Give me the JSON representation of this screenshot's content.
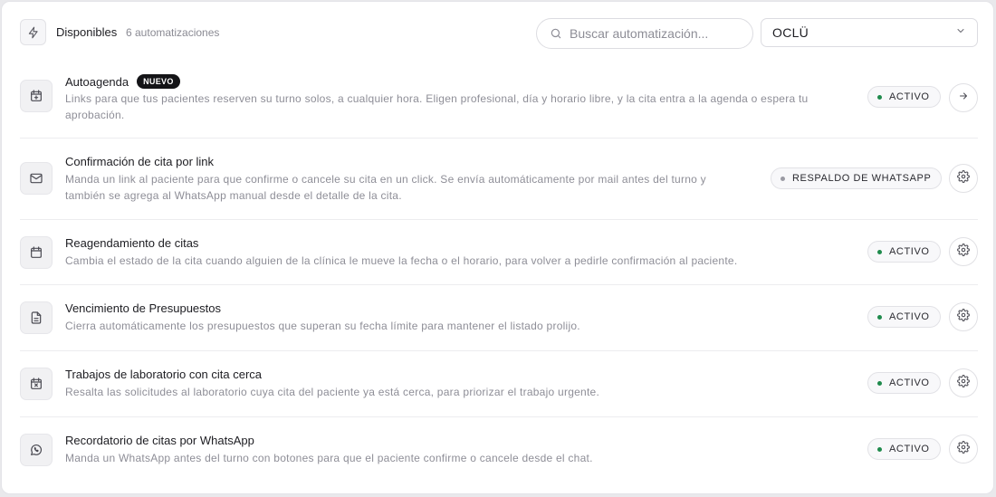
{
  "header": {
    "icon": "bolt-icon",
    "title": "Disponibles",
    "count": "6 automatizaciones",
    "search_placeholder": "Buscar automatización...",
    "select_value": "OCLÜ"
  },
  "colors": {
    "active_dot": "#1f8a4c",
    "backup_dot": "#9a9aa3",
    "badge_bg": "#141417"
  },
  "automations": [
    {
      "icon": "calendar-plus-icon",
      "name": "Autoagenda",
      "badge": "NUEVO",
      "desc_line1": "Links para que tus pacientes reserven su turno solos, a cualquier hora. Eligen profesional, día y horario libre, y la cita entra a la agenda o espera tu",
      "desc_line2": "aprobación.",
      "status": "ACTIVO",
      "action_icon": "arrow-right-icon"
    },
    {
      "icon": "mail-icon",
      "name": "Confirmación de cita por link",
      "desc_line1": "Manda un link al paciente para que confirme o cancele su cita en un click. Se envía automáticamente por mail antes del turno y",
      "desc_line2": "también se agrega al WhatsApp manual desde el detalle de la cita.",
      "status": "RESPALDO DE WHATSAPP",
      "action_icon": "gear-icon"
    },
    {
      "icon": "calendar-icon",
      "name": "Reagendamiento de citas",
      "desc_line1": "Cambia el estado de la cita cuando alguien de la clínica le mueve la fecha o el horario, para volver a pedirle confirmación al paciente.",
      "status": "ACTIVO",
      "action_icon": "gear-icon"
    },
    {
      "icon": "document-icon",
      "name": "Vencimiento de Presupuestos",
      "desc_line1": "Cierra automáticamente los presupuestos que superan su fecha límite para mantener el listado prolijo.",
      "status": "ACTIVO",
      "action_icon": "gear-icon"
    },
    {
      "icon": "calendar-x-icon",
      "name": "Trabajos de laboratorio con cita cerca",
      "desc_line1": "Resalta las solicitudes al laboratorio cuya cita del paciente ya está cerca, para priorizar el trabajo urgente.",
      "status": "ACTIVO",
      "action_icon": "gear-icon"
    },
    {
      "icon": "whatsapp-icon",
      "name": "Recordatorio de citas por WhatsApp",
      "desc_line1": "Manda un WhatsApp antes del turno con botones para que el paciente confirme o cancele desde el chat.",
      "status": "ACTIVO",
      "action_icon": "gear-icon"
    }
  ]
}
